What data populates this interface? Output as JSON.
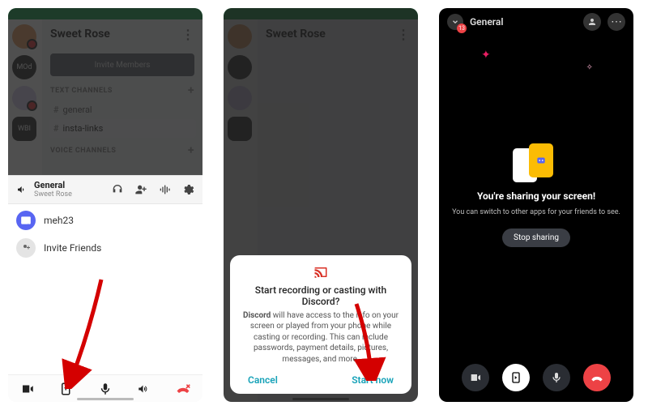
{
  "phone1": {
    "server_title": "Sweet Rose",
    "invite_members": "Invite Members",
    "text_channels_header": "TEXT CHANNELS",
    "text_channels": [
      {
        "name": "general"
      },
      {
        "name": "insta-links"
      }
    ],
    "voice_channels_header": "VOICE CHANNELS",
    "voice_bar": {
      "channel": "General",
      "server": "Sweet Rose"
    },
    "participants": [
      {
        "name": "meh23"
      },
      {
        "name": "Invite Friends"
      }
    ],
    "servers": [
      {
        "label": "",
        "color": "#e6a06a"
      },
      {
        "label": "MOd",
        "color": "#3a3a3a",
        "text": "#fff"
      },
      {
        "label": "",
        "color": "#d9d0f0"
      },
      {
        "label": "WBI",
        "color": "#3a3a3a",
        "text": "#fff"
      }
    ]
  },
  "phone2": {
    "dialog": {
      "title": "Start recording or casting with Discord?",
      "body_prefix": "Discord",
      "body": " will have access to the info on your screen or played from your phone while casting or recording. This can include passwords, payment details, pictures, messages, and more.",
      "cancel": "Cancel",
      "start": "Start now"
    }
  },
  "phone3": {
    "title": "General",
    "close_badge": "13",
    "heading": "You're sharing your screen!",
    "subtext": "You can switch to other apps for your friends to see.",
    "stop": "Stop sharing"
  },
  "colors": {
    "teal": "#17a2b8",
    "red": "#ed4245",
    "accent": "#5865F2"
  }
}
